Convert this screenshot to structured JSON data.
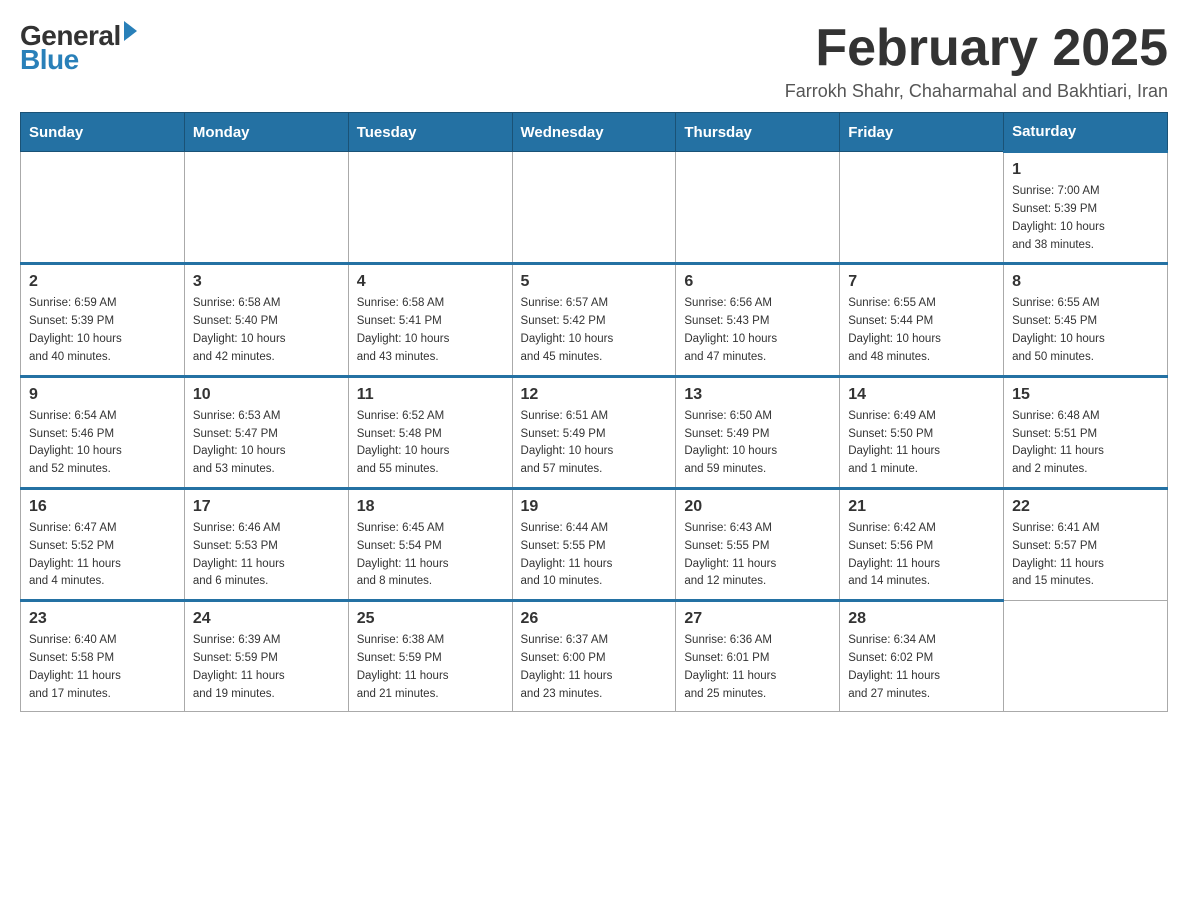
{
  "header": {
    "logo_general": "General",
    "logo_blue": "Blue",
    "month_title": "February 2025",
    "subtitle": "Farrokh Shahr, Chaharmahal and Bakhtiari, Iran"
  },
  "days_of_week": [
    "Sunday",
    "Monday",
    "Tuesday",
    "Wednesday",
    "Thursday",
    "Friday",
    "Saturday"
  ],
  "weeks": [
    [
      {
        "day": "",
        "info": ""
      },
      {
        "day": "",
        "info": ""
      },
      {
        "day": "",
        "info": ""
      },
      {
        "day": "",
        "info": ""
      },
      {
        "day": "",
        "info": ""
      },
      {
        "day": "",
        "info": ""
      },
      {
        "day": "1",
        "info": "Sunrise: 7:00 AM\nSunset: 5:39 PM\nDaylight: 10 hours\nand 38 minutes."
      }
    ],
    [
      {
        "day": "2",
        "info": "Sunrise: 6:59 AM\nSunset: 5:39 PM\nDaylight: 10 hours\nand 40 minutes."
      },
      {
        "day": "3",
        "info": "Sunrise: 6:58 AM\nSunset: 5:40 PM\nDaylight: 10 hours\nand 42 minutes."
      },
      {
        "day": "4",
        "info": "Sunrise: 6:58 AM\nSunset: 5:41 PM\nDaylight: 10 hours\nand 43 minutes."
      },
      {
        "day": "5",
        "info": "Sunrise: 6:57 AM\nSunset: 5:42 PM\nDaylight: 10 hours\nand 45 minutes."
      },
      {
        "day": "6",
        "info": "Sunrise: 6:56 AM\nSunset: 5:43 PM\nDaylight: 10 hours\nand 47 minutes."
      },
      {
        "day": "7",
        "info": "Sunrise: 6:55 AM\nSunset: 5:44 PM\nDaylight: 10 hours\nand 48 minutes."
      },
      {
        "day": "8",
        "info": "Sunrise: 6:55 AM\nSunset: 5:45 PM\nDaylight: 10 hours\nand 50 minutes."
      }
    ],
    [
      {
        "day": "9",
        "info": "Sunrise: 6:54 AM\nSunset: 5:46 PM\nDaylight: 10 hours\nand 52 minutes."
      },
      {
        "day": "10",
        "info": "Sunrise: 6:53 AM\nSunset: 5:47 PM\nDaylight: 10 hours\nand 53 minutes."
      },
      {
        "day": "11",
        "info": "Sunrise: 6:52 AM\nSunset: 5:48 PM\nDaylight: 10 hours\nand 55 minutes."
      },
      {
        "day": "12",
        "info": "Sunrise: 6:51 AM\nSunset: 5:49 PM\nDaylight: 10 hours\nand 57 minutes."
      },
      {
        "day": "13",
        "info": "Sunrise: 6:50 AM\nSunset: 5:49 PM\nDaylight: 10 hours\nand 59 minutes."
      },
      {
        "day": "14",
        "info": "Sunrise: 6:49 AM\nSunset: 5:50 PM\nDaylight: 11 hours\nand 1 minute."
      },
      {
        "day": "15",
        "info": "Sunrise: 6:48 AM\nSunset: 5:51 PM\nDaylight: 11 hours\nand 2 minutes."
      }
    ],
    [
      {
        "day": "16",
        "info": "Sunrise: 6:47 AM\nSunset: 5:52 PM\nDaylight: 11 hours\nand 4 minutes."
      },
      {
        "day": "17",
        "info": "Sunrise: 6:46 AM\nSunset: 5:53 PM\nDaylight: 11 hours\nand 6 minutes."
      },
      {
        "day": "18",
        "info": "Sunrise: 6:45 AM\nSunset: 5:54 PM\nDaylight: 11 hours\nand 8 minutes."
      },
      {
        "day": "19",
        "info": "Sunrise: 6:44 AM\nSunset: 5:55 PM\nDaylight: 11 hours\nand 10 minutes."
      },
      {
        "day": "20",
        "info": "Sunrise: 6:43 AM\nSunset: 5:55 PM\nDaylight: 11 hours\nand 12 minutes."
      },
      {
        "day": "21",
        "info": "Sunrise: 6:42 AM\nSunset: 5:56 PM\nDaylight: 11 hours\nand 14 minutes."
      },
      {
        "day": "22",
        "info": "Sunrise: 6:41 AM\nSunset: 5:57 PM\nDaylight: 11 hours\nand 15 minutes."
      }
    ],
    [
      {
        "day": "23",
        "info": "Sunrise: 6:40 AM\nSunset: 5:58 PM\nDaylight: 11 hours\nand 17 minutes."
      },
      {
        "day": "24",
        "info": "Sunrise: 6:39 AM\nSunset: 5:59 PM\nDaylight: 11 hours\nand 19 minutes."
      },
      {
        "day": "25",
        "info": "Sunrise: 6:38 AM\nSunset: 5:59 PM\nDaylight: 11 hours\nand 21 minutes."
      },
      {
        "day": "26",
        "info": "Sunrise: 6:37 AM\nSunset: 6:00 PM\nDaylight: 11 hours\nand 23 minutes."
      },
      {
        "day": "27",
        "info": "Sunrise: 6:36 AM\nSunset: 6:01 PM\nDaylight: 11 hours\nand 25 minutes."
      },
      {
        "day": "28",
        "info": "Sunrise: 6:34 AM\nSunset: 6:02 PM\nDaylight: 11 hours\nand 27 minutes."
      },
      {
        "day": "",
        "info": ""
      }
    ]
  ]
}
